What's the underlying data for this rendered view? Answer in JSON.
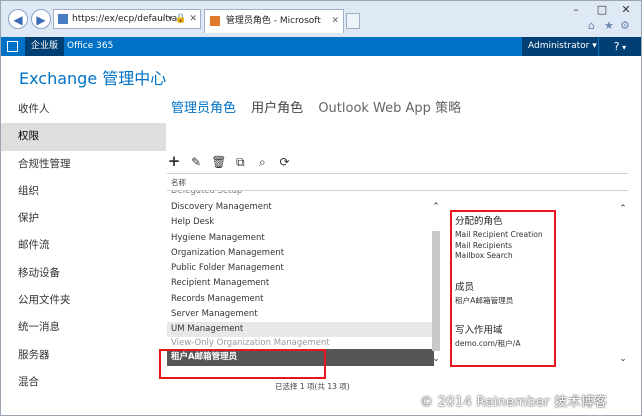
{
  "browser": {
    "url": "https://ex/ecp/default.a",
    "tab_title": "管理员角色 - Microsoft Ex...",
    "back_icon": "back-arrow-icon",
    "forward_icon": "forward-arrow-icon"
  },
  "o365_bar": {
    "enterprise_label": "企业版",
    "office365_label": "Office 365",
    "admin_label": "Administrator",
    "help_label": "?"
  },
  "app": {
    "title": "Exchange 管理中心"
  },
  "left_nav": {
    "items": [
      {
        "label": "收件人"
      },
      {
        "label": "权限"
      },
      {
        "label": "合规性管理"
      },
      {
        "label": "组织"
      },
      {
        "label": "保护"
      },
      {
        "label": "邮件流"
      },
      {
        "label": "移动设备"
      },
      {
        "label": "公用文件夹"
      },
      {
        "label": "统一消息"
      },
      {
        "label": "服务器"
      },
      {
        "label": "混合"
      }
    ],
    "selected_index": 1
  },
  "sub_tabs": [
    {
      "label": "管理员角色"
    },
    {
      "label": "用户角色"
    },
    {
      "label": "Outlook Web App 策略"
    }
  ],
  "toolbar": {
    "icons": [
      "add-icon",
      "edit-icon",
      "delete-icon",
      "copy-icon",
      "search-icon",
      "refresh-icon"
    ]
  },
  "role_list": {
    "column_header": "名称",
    "rows": [
      "Delegated Setup",
      "Discovery Management",
      "Help Desk",
      "Hygiene Management",
      "Organization Management",
      "Public Folder Management",
      "Recipient Management",
      "Records Management",
      "Server Management",
      "UM Management",
      "View-Only Organization Management",
      "租户A邮箱管理员"
    ],
    "status": "已选择 1 项(共 13 项)"
  },
  "details": {
    "assigned_roles_title": "分配的角色",
    "assigned_roles": [
      "Mail Recipient Creation",
      "Mail Recipients",
      "Mailbox Search"
    ],
    "members_title": "成员",
    "members": "租户A邮箱管理员",
    "scope_title": "写入作用域",
    "scope": "demo.com/租户/A"
  },
  "watermark": "© 2014 Reinember 技术博客"
}
